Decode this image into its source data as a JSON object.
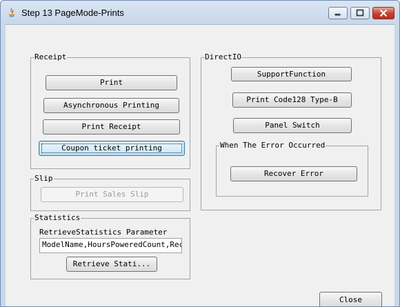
{
  "window": {
    "title": "Step 13  PageMode-Prints"
  },
  "receipt": {
    "label": "Receipt",
    "print": "Print",
    "async_printing": "Asynchronous Printing",
    "print_receipt": "Print Receipt",
    "coupon_printing": "Coupon ticket printing"
  },
  "slip": {
    "label": "Slip",
    "print_sales_slip": "Print Sales Slip"
  },
  "statistics": {
    "label": "Statistics",
    "param_label": "RetrieveStatistics Parameter",
    "param_value": "ModelName,HoursPoweredCount,Receip",
    "retrieve": "Retrieve Stati..."
  },
  "directio": {
    "label": "DirectIO",
    "support_function": "SupportFunction",
    "print_code128": "Print Code128 Type-B",
    "panel_switch": "Panel Switch"
  },
  "error_group": {
    "label": "When The Error Occurred",
    "recover": "Recover Error"
  },
  "footer": {
    "close": "Close"
  },
  "colors": {
    "title_gradient": "#c9d8ea",
    "client_bg": "#f0f0f0",
    "close_btn": "#c5412d"
  }
}
